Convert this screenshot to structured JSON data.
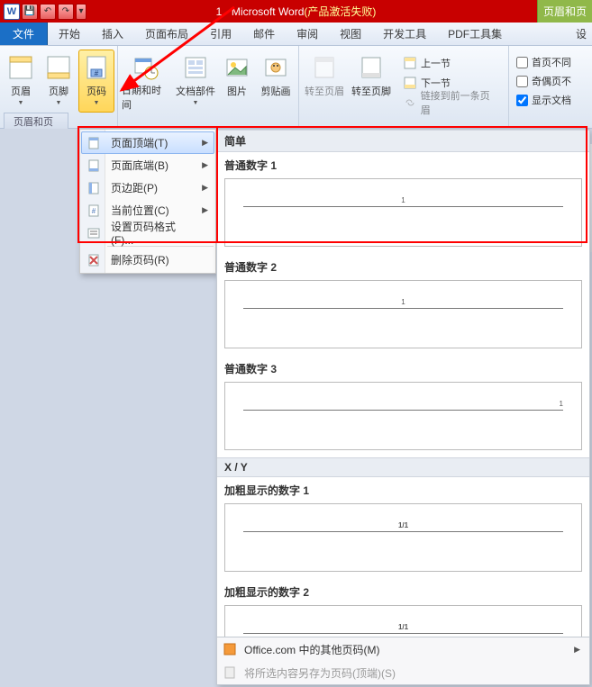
{
  "titlebar": {
    "doc_title": "1 - Microsoft Word",
    "fail_text": "(产品激活失败)",
    "qat_save": "💾",
    "qat_undo": "↶",
    "qat_redo": "↷",
    "extra_tab": "页眉和页"
  },
  "tabs": {
    "file": "文件",
    "home": "开始",
    "insert": "插入",
    "layout": "页面布局",
    "refs": "引用",
    "mail": "邮件",
    "review": "审阅",
    "view": "视图",
    "dev": "开发工具",
    "pdf": "PDF工具集",
    "design": "设"
  },
  "ribbon": {
    "header": "页眉",
    "footer": "页脚",
    "page_number": "页码",
    "date_time": "日期和时间",
    "doc_parts": "文档部件",
    "picture": "图片",
    "clipart": "剪贴画",
    "goto_header": "转至页眉",
    "goto_footer": "转至页脚",
    "prev_section": "上一节",
    "next_section": "下一节",
    "link_prev": "链接到前一条页眉",
    "diff_first": "首页不同",
    "diff_oddeven": "奇偶页不",
    "show_doc": "显示文档",
    "group_label": "页眉和页"
  },
  "menu": {
    "top": "页面顶端(T)",
    "bottom": "页面底端(B)",
    "margin": "页边距(P)",
    "current": "当前位置(C)",
    "format": "设置页码格式(F)...",
    "remove": "删除页码(R)"
  },
  "gallery": {
    "sec_simple": "简单",
    "item1": "普通数字 1",
    "item2": "普通数字 2",
    "item3": "普通数字 3",
    "sec_xy": "X / Y",
    "item4": "加粗显示的数字 1",
    "item5": "加粗显示的数字 2",
    "preview_num_single": "1",
    "preview_num_xy": "1/1",
    "footer_office": "Office.com 中的其他页码(M)",
    "footer_save": "将所选内容另存为页码(顶端)(S)"
  }
}
